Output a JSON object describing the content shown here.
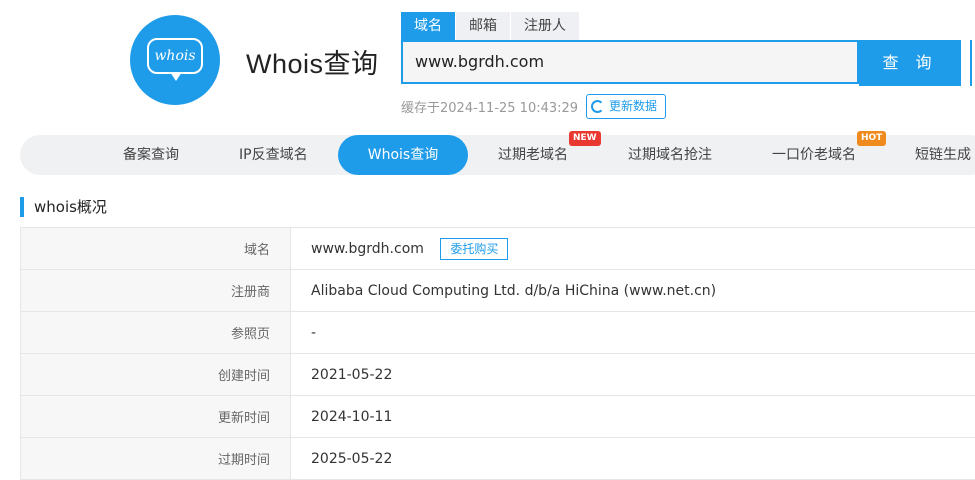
{
  "header": {
    "logo_text": "whois",
    "site_title": "Whois查询",
    "search_tabs": [
      "域名",
      "邮箱",
      "注册人"
    ],
    "search_value": "www.bgrdh.com",
    "search_button": "查 询",
    "cache_text": "缓存于2024-11-25 10:43:29",
    "refresh_label": "更新数据"
  },
  "nav": {
    "items": [
      "备案查询",
      "IP反查域名",
      "Whois查询",
      "过期老域名",
      "过期域名抢注",
      "一口价老域名",
      "短链生成"
    ],
    "active_index": 2,
    "badge_new": "NEW",
    "badge_hot": "HOT"
  },
  "section": {
    "title": "whois概况",
    "entrust_label": "委托购买",
    "rows": [
      {
        "label": "域名",
        "value": "www.bgrdh.com"
      },
      {
        "label": "注册商",
        "value": "Alibaba Cloud Computing Ltd. d/b/a HiChina (www.net.cn)"
      },
      {
        "label": "参照页",
        "value": "-"
      },
      {
        "label": "创建时间",
        "value": "2021-05-22"
      },
      {
        "label": "更新时间",
        "value": "2024-10-11"
      },
      {
        "label": "过期时间",
        "value": "2025-05-22"
      }
    ]
  },
  "colors": {
    "accent": "#1e9be9",
    "badge_new": "#e8382f",
    "badge_hot": "#f08a1c"
  }
}
